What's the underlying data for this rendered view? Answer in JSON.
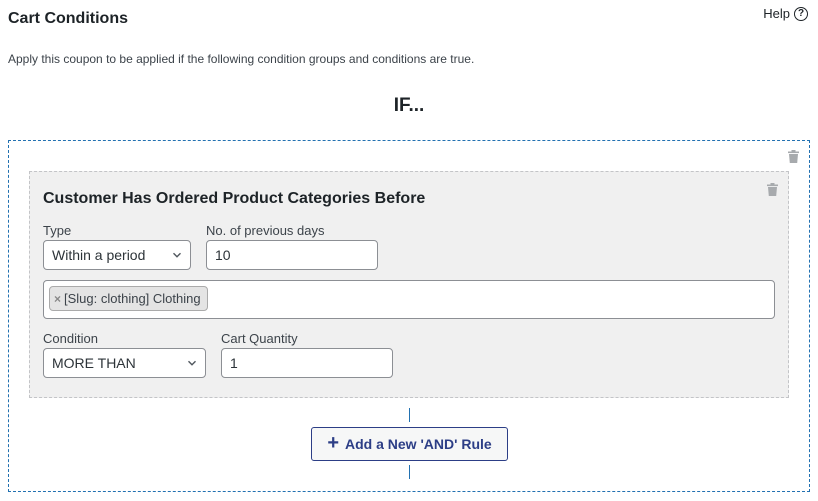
{
  "header": {
    "title": "Cart Conditions",
    "help_label": "Help",
    "help_icon": "question-circle-icon",
    "description": "Apply this coupon to be applied if the following condition groups and conditions are true."
  },
  "if_label": "IF...",
  "group": {
    "delete_icon": "trash-icon",
    "rule": {
      "title": "Customer Has Ordered Product Categories Before",
      "delete_icon": "trash-icon",
      "type": {
        "label": "Type",
        "value": "Within a period"
      },
      "previous_days": {
        "label": "No. of previous days",
        "value": "10"
      },
      "categories": [
        {
          "remove_glyph": "×",
          "label": "[Slug: clothing] Clothing"
        }
      ],
      "condition": {
        "label": "Condition",
        "value": "MORE THAN"
      },
      "cart_quantity": {
        "label": "Cart Quantity",
        "value": "1"
      }
    },
    "add_rule_button": {
      "icon": "+",
      "label": "Add a New 'AND' Rule"
    }
  },
  "colors": {
    "accent_blue": "#2271b1",
    "button_text": "#2c3e86",
    "rule_bg": "#f0f0f0"
  }
}
